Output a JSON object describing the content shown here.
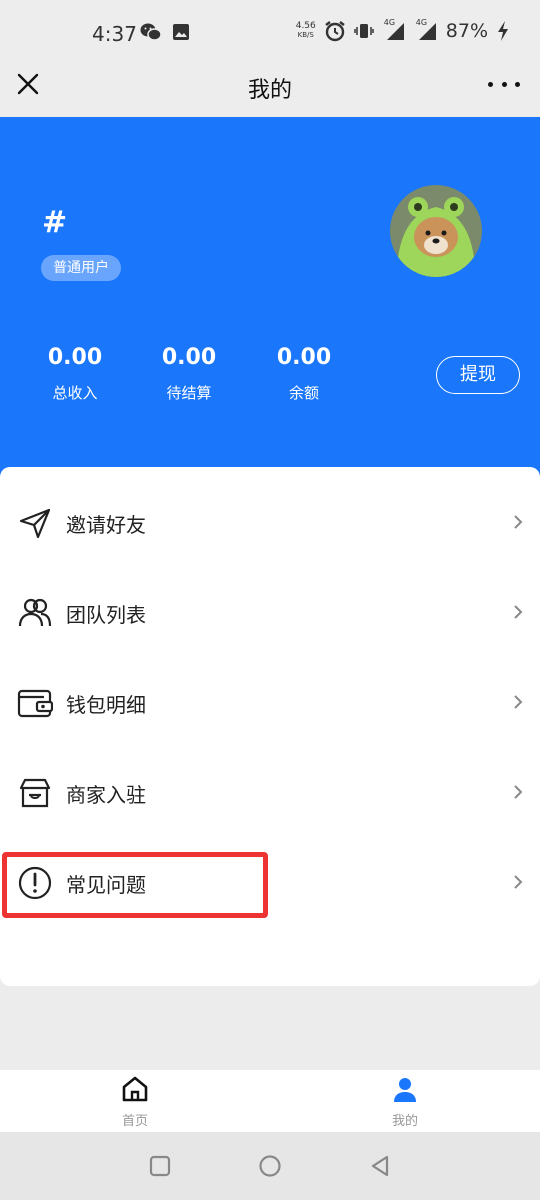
{
  "status_bar": {
    "time": "4:37",
    "net_speed_value": "4.56",
    "net_speed_unit": "KB/S",
    "network_1": "4G",
    "network_2": "4G",
    "battery": "87%"
  },
  "nav": {
    "title": "我的"
  },
  "profile": {
    "name": "#",
    "badge": "普通用户"
  },
  "stats": [
    {
      "value": "0.00",
      "label": "总收入"
    },
    {
      "value": "0.00",
      "label": "待结算"
    },
    {
      "value": "0.00",
      "label": "余额"
    }
  ],
  "withdraw_label": "提现",
  "menu": [
    {
      "label": "邀请好友",
      "icon": "send-icon"
    },
    {
      "label": "团队列表",
      "icon": "team-icon"
    },
    {
      "label": "钱包明细",
      "icon": "wallet-icon"
    },
    {
      "label": "商家入驻",
      "icon": "store-icon"
    },
    {
      "label": "常见问题",
      "icon": "alert-circle-icon"
    }
  ],
  "tabs": [
    {
      "label": "首页",
      "icon": "home-icon"
    },
    {
      "label": "我的",
      "icon": "user-icon"
    }
  ],
  "colors": {
    "accent": "#1a76fa",
    "highlight": "#ee3333"
  }
}
